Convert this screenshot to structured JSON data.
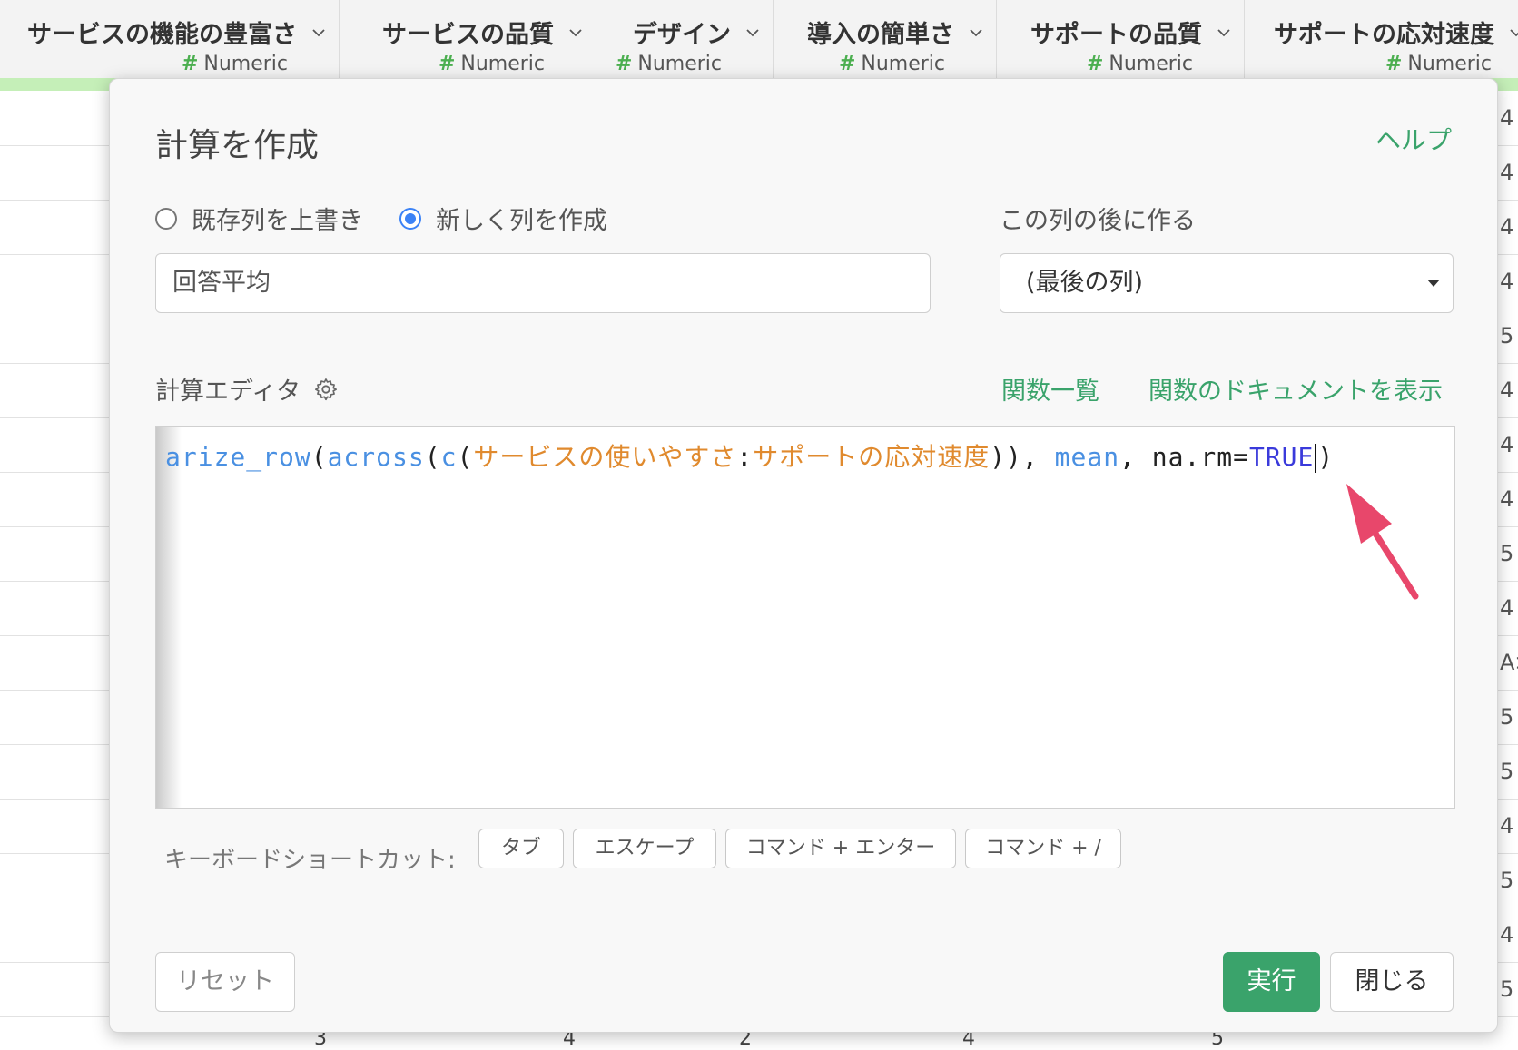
{
  "table": {
    "columns": [
      {
        "name": "サービスの機能の豊富さ",
        "type": "Numeric"
      },
      {
        "name": "サービスの品質",
        "type": "Numeric"
      },
      {
        "name": "デザイン",
        "type": "Numeric"
      },
      {
        "name": "導入の簡単さ",
        "type": "Numeric"
      },
      {
        "name": "サポートの品質",
        "type": "Numeric"
      },
      {
        "name": "サポートの応対速度",
        "type": "Numeric"
      }
    ],
    "type_hash": "#",
    "side_values": [
      "4",
      "4",
      "4",
      "4",
      "5",
      "4",
      "4",
      "4",
      "5",
      "4",
      "A>",
      "5",
      "5",
      "4",
      "5",
      "4",
      "5"
    ],
    "bottom_values": [
      "3",
      "4",
      "2",
      "4",
      "5"
    ]
  },
  "dialog": {
    "title": "計算を作成",
    "help": "ヘルプ",
    "radio_overwrite": "既存列を上書き",
    "radio_new": "新しく列を作成",
    "after_label": "この列の後に作る",
    "column_name_value": "回答平均",
    "after_select_value": "(最後の列)",
    "editor_label": "計算エディタ",
    "func_list": "関数一覧",
    "func_doc": "関数のドキュメントを表示",
    "code": {
      "t1": "arize_row",
      "t2": "(",
      "t3": "across",
      "t4": "(",
      "t5": "c",
      "t6": "(",
      "t7": "サービスの使いやすさ",
      "t8": ":",
      "t9": "サポートの応対速度",
      "t10": ")), ",
      "t11": "mean",
      "t12": ", na.rm=",
      "t13": "TRUE",
      "t14": ")"
    },
    "shortcut_label": "キーボードショートカット:",
    "shortcuts": [
      "タブ",
      "エスケープ",
      "コマンド + エンター",
      "コマンド + /"
    ],
    "reset": "リセット",
    "run": "実行",
    "close": "閉じる"
  },
  "colors": {
    "accent_green": "#3aa36b",
    "header_bar_green": "#c5efb8",
    "code_function": "#4a90e2",
    "code_column": "#e08a2e",
    "code_constant": "#3a3adb",
    "arrow": "#e8476b",
    "radio_selected": "#3b82f6"
  }
}
